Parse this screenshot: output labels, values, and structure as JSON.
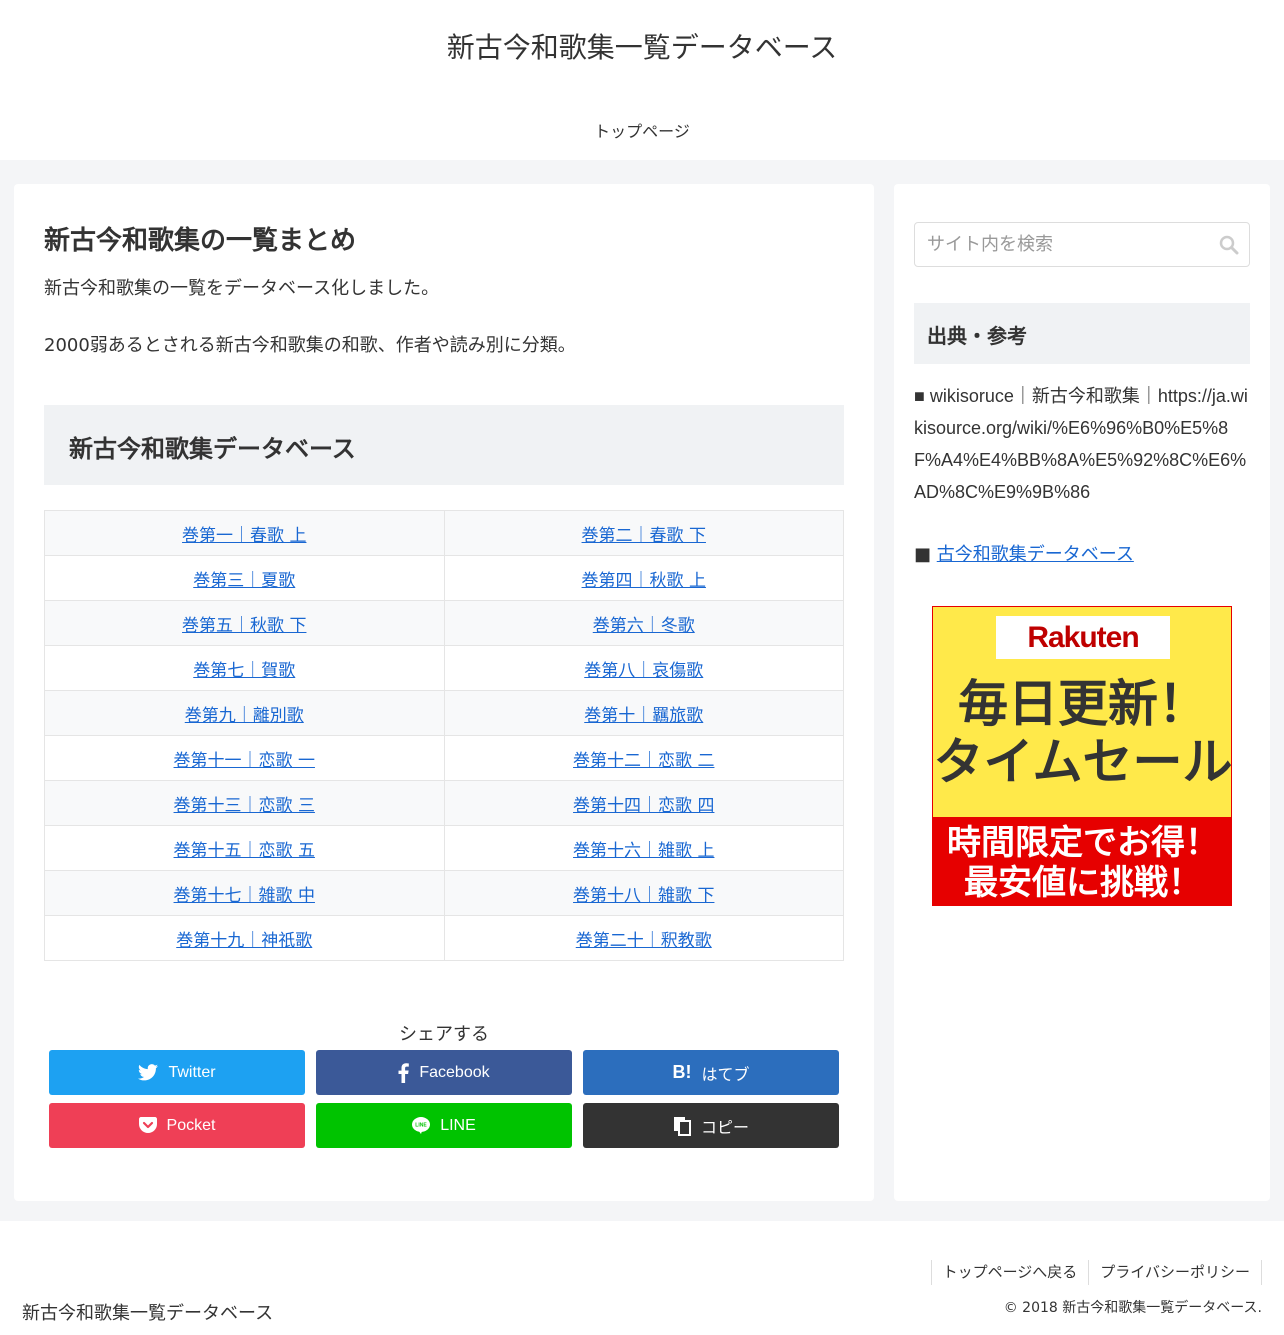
{
  "header": {
    "site_title": "新古今和歌集一覧データベース",
    "nav_item": "トップページ"
  },
  "article": {
    "title": "新古今和歌集の一覧まとめ",
    "intro1": "新古今和歌集の一覧をデータベース化しました。",
    "intro2": "2000弱あるとされる新古今和歌集の和歌、作者や読み別に分類。",
    "db_heading": "新古今和歌集データベース",
    "volumes": [
      [
        "巻第一｜春歌 上",
        "巻第二｜春歌 下"
      ],
      [
        "巻第三｜夏歌",
        "巻第四｜秋歌 上"
      ],
      [
        "巻第五｜秋歌 下",
        "巻第六｜冬歌"
      ],
      [
        "巻第七｜賀歌",
        "巻第八｜哀傷歌"
      ],
      [
        "巻第九｜離別歌",
        "巻第十｜羈旅歌"
      ],
      [
        "巻第十一｜恋歌 一",
        "巻第十二｜恋歌 二"
      ],
      [
        "巻第十三｜恋歌 三",
        "巻第十四｜恋歌 四"
      ],
      [
        "巻第十五｜恋歌 五",
        "巻第十六｜雑歌 上"
      ],
      [
        "巻第十七｜雑歌 中",
        "巻第十八｜雑歌 下"
      ],
      [
        "巻第十九｜神祇歌",
        "巻第二十｜釈教歌"
      ]
    ]
  },
  "share": {
    "label": "シェアする",
    "twitter": "Twitter",
    "facebook": "Facebook",
    "hatena": "はてブ",
    "pocket": "Pocket",
    "line": "LINE",
    "copy": "コピー"
  },
  "sidebar": {
    "search_placeholder": "サイト内を検索",
    "source_heading": "出典・参考",
    "source_text": "■ wikisoruce｜新古今和歌集｜https://ja.wikisource.org/wiki/%E6%96%B0%E5%8F%A4%E4%BB%8A%E5%92%8C%E6%AD%8C%E9%9B%86",
    "link_prefix": "■ ",
    "link_label": "古今和歌集データベース",
    "ad": {
      "logo": "Rakuten",
      "line1": "毎日更新！",
      "line2": "タイムセール",
      "line3": "時間限定でお得！",
      "line4": "最安値に挑戦！"
    }
  },
  "footer": {
    "site_title": "新古今和歌集一覧データベース",
    "nav": [
      "トップページへ戻る",
      "プライバシーポリシー"
    ],
    "copyright": "© 2018 新古今和歌集一覧データベース."
  },
  "colors": {
    "twitter": "#1da1f2",
    "facebook": "#3b5998",
    "hatena": "#2c6ebd",
    "pocket": "#ef3f56",
    "line": "#00c300",
    "copy": "#333333",
    "link": "#1967d2"
  }
}
